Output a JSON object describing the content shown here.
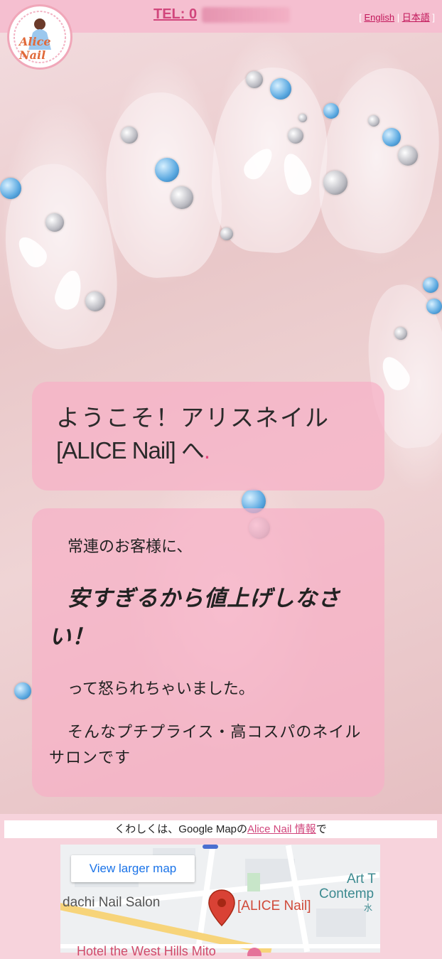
{
  "header": {
    "tel_label": "TEL: 0",
    "lang_english": "English",
    "lang_japanese": "日本語",
    "lang_open": "[",
    "lang_sep": "|",
    "lang_close": "]"
  },
  "logo": {
    "text": "Alice Nail"
  },
  "welcome": {
    "line1": "ようこそ！アリスネイル",
    "line2": "[ALICE Nail] へ",
    "dot": "."
  },
  "promo": {
    "line1": "常連のお客様に、",
    "line2": "安すぎるから値上げしなさい！",
    "line3": "って怒られちゃいました。",
    "line4": "そんなプチプライス・高コスパのネイルサロンです"
  },
  "info": {
    "prefix": "くわしくは、Google Mapの",
    "link": "Alice Nail 情報",
    "suffix": "で"
  },
  "map": {
    "view_larger": "View larger map",
    "nearby_salon": "dachi Nail Salon",
    "pin_label": "[ALICE Nail]",
    "art_label_1": "Art T",
    "art_label_2": "Contemp",
    "kanji_label": "水",
    "hotel_label": "Hotel the West Hills Mito"
  },
  "colors": {
    "header_bg": "#f5bfd0",
    "accent_pink": "#d1467c",
    "card_bg": "#f6b0c6",
    "page_bg": "#f7d3dc",
    "map_link_blue": "#1a73e8"
  }
}
